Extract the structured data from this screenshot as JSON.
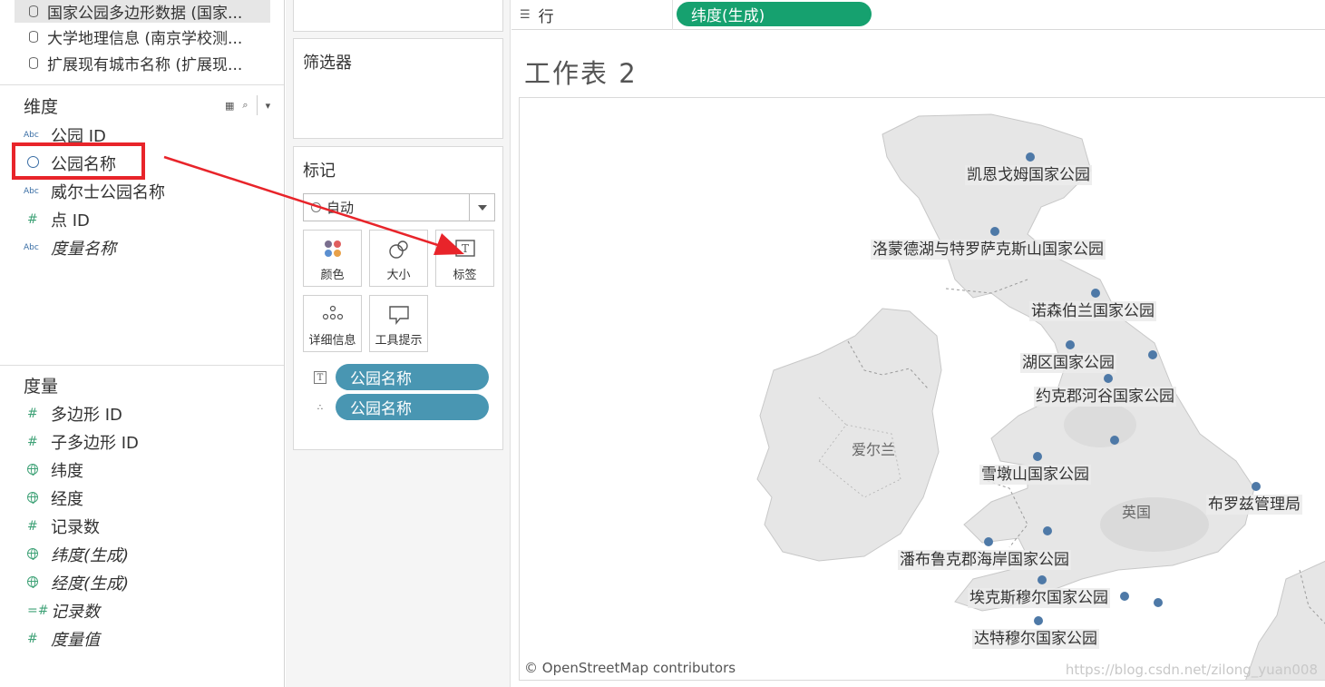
{
  "data_sources": [
    {
      "label": "国家公园多边形数据 (国家...",
      "selected": true
    },
    {
      "label": "大学地理信息 (南京学校测...",
      "selected": false
    },
    {
      "label": "扩展现有城市名称 (扩展现...",
      "selected": false
    }
  ],
  "dimensions": {
    "title": "维度",
    "fields": [
      {
        "type": "Abc",
        "label": "公园 ID"
      },
      {
        "type": "geo",
        "label": "公园名称"
      },
      {
        "type": "Abc",
        "label": "威尔士公园名称"
      },
      {
        "type": "#",
        "label": "点 ID"
      },
      {
        "type": "Abc",
        "label": "度量名称"
      }
    ]
  },
  "measures": {
    "title": "度量",
    "fields": [
      {
        "type": "#",
        "label": "多边形 ID"
      },
      {
        "type": "#",
        "label": "子多边形 ID"
      },
      {
        "type": "globe",
        "label": "纬度"
      },
      {
        "type": "globe",
        "label": "经度"
      },
      {
        "type": "#",
        "label": "记录数"
      },
      {
        "type": "globe",
        "label": "纬度(生成)"
      },
      {
        "type": "globe",
        "label": "经度(生成)"
      },
      {
        "type": "=#",
        "label": "记录数"
      },
      {
        "type": "#",
        "label": "度量值"
      }
    ]
  },
  "filters": {
    "title": "筛选器"
  },
  "marks": {
    "title": "标记",
    "mark_type": "自动",
    "buttons": [
      "颜色",
      "大小",
      "标签",
      "详细信息",
      "工具提示"
    ],
    "pills": [
      {
        "icon": "T",
        "label": "公园名称"
      },
      {
        "icon": "∴",
        "label": "公园名称"
      }
    ]
  },
  "rows": {
    "label": "行",
    "pill": "纬度(生成)"
  },
  "sheet": {
    "title": "工作表 2"
  },
  "map": {
    "country_labels": [
      "爱尔兰",
      "英国"
    ],
    "park_labels": [
      "凯恩戈姆国家公园",
      "洛蒙德湖与特罗萨克斯山国家公园",
      "诺森伯兰国家公园",
      "湖区国家公园",
      "约克郡河谷国家公园",
      "雪墩山国家公园",
      "布罗兹管理局",
      "潘布鲁克郡海岸国家公园",
      "埃克斯穆尔国家公园",
      "达特穆尔国家公园"
    ],
    "attribution": "© OpenStreetMap contributors",
    "dot_color": "#4e79a7"
  },
  "watermark": "https://blog.csdn.net/zilong_yuan008",
  "colors": {
    "pill_dimension": "#4996b2",
    "pill_measure": "#16a16f",
    "highlight": "#e8242a"
  }
}
